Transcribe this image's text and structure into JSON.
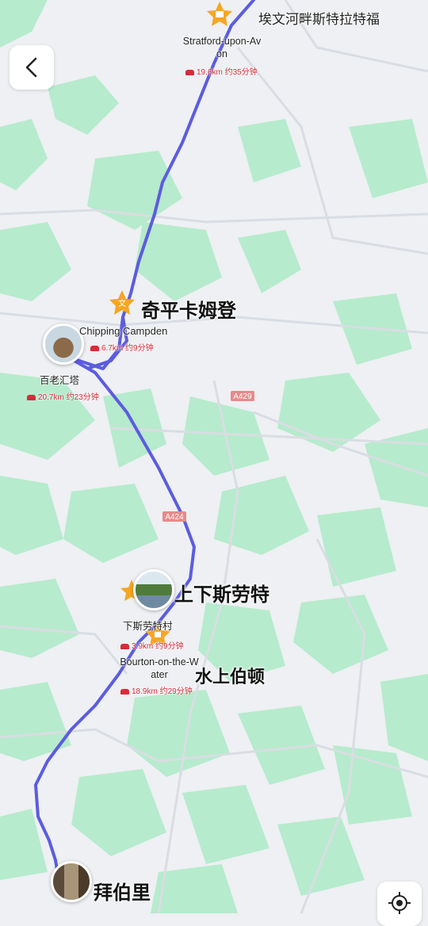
{
  "map": {
    "route_color": "#5c5ce0",
    "green": "#a8e6c4",
    "road_tags": [
      "A429",
      "A424"
    ]
  },
  "places": {
    "stratford": {
      "name_cn": "埃文河畔斯特拉特福",
      "name_en_line1": "Stratford-upon-Av",
      "name_en_line2": "on",
      "dist": "19.6km 约35分钟",
      "icon": "shop-star-icon"
    },
    "chipping": {
      "name_cn": "奇平卡姆登",
      "name_en": "Chipping Campden",
      "dist": "6.7km 约9分钟",
      "icon": "culture-star-icon"
    },
    "broadway": {
      "name_cn": "百老汇塔",
      "dist": "20.7km 约23分钟",
      "icon": "tower-photo"
    },
    "slaughters": {
      "name_cn": "上下斯劳特",
      "icon": "village-photo"
    },
    "lower_slaughter": {
      "name_cn": "下斯劳特村",
      "dist": "3.9km 约9分钟"
    },
    "bourton": {
      "name_en_line1": "Bourton-on-the-W",
      "name_en_line2": "ater",
      "name_cn": "水上伯顿",
      "dist": "18.9km 约29分钟",
      "icon": "home-star-icon"
    },
    "bibury": {
      "name_cn": "拜伯里",
      "icon": "bibury-photo"
    }
  },
  "controls": {
    "back_icon": "chevron-left-icon",
    "locate_icon": "locate-icon"
  }
}
